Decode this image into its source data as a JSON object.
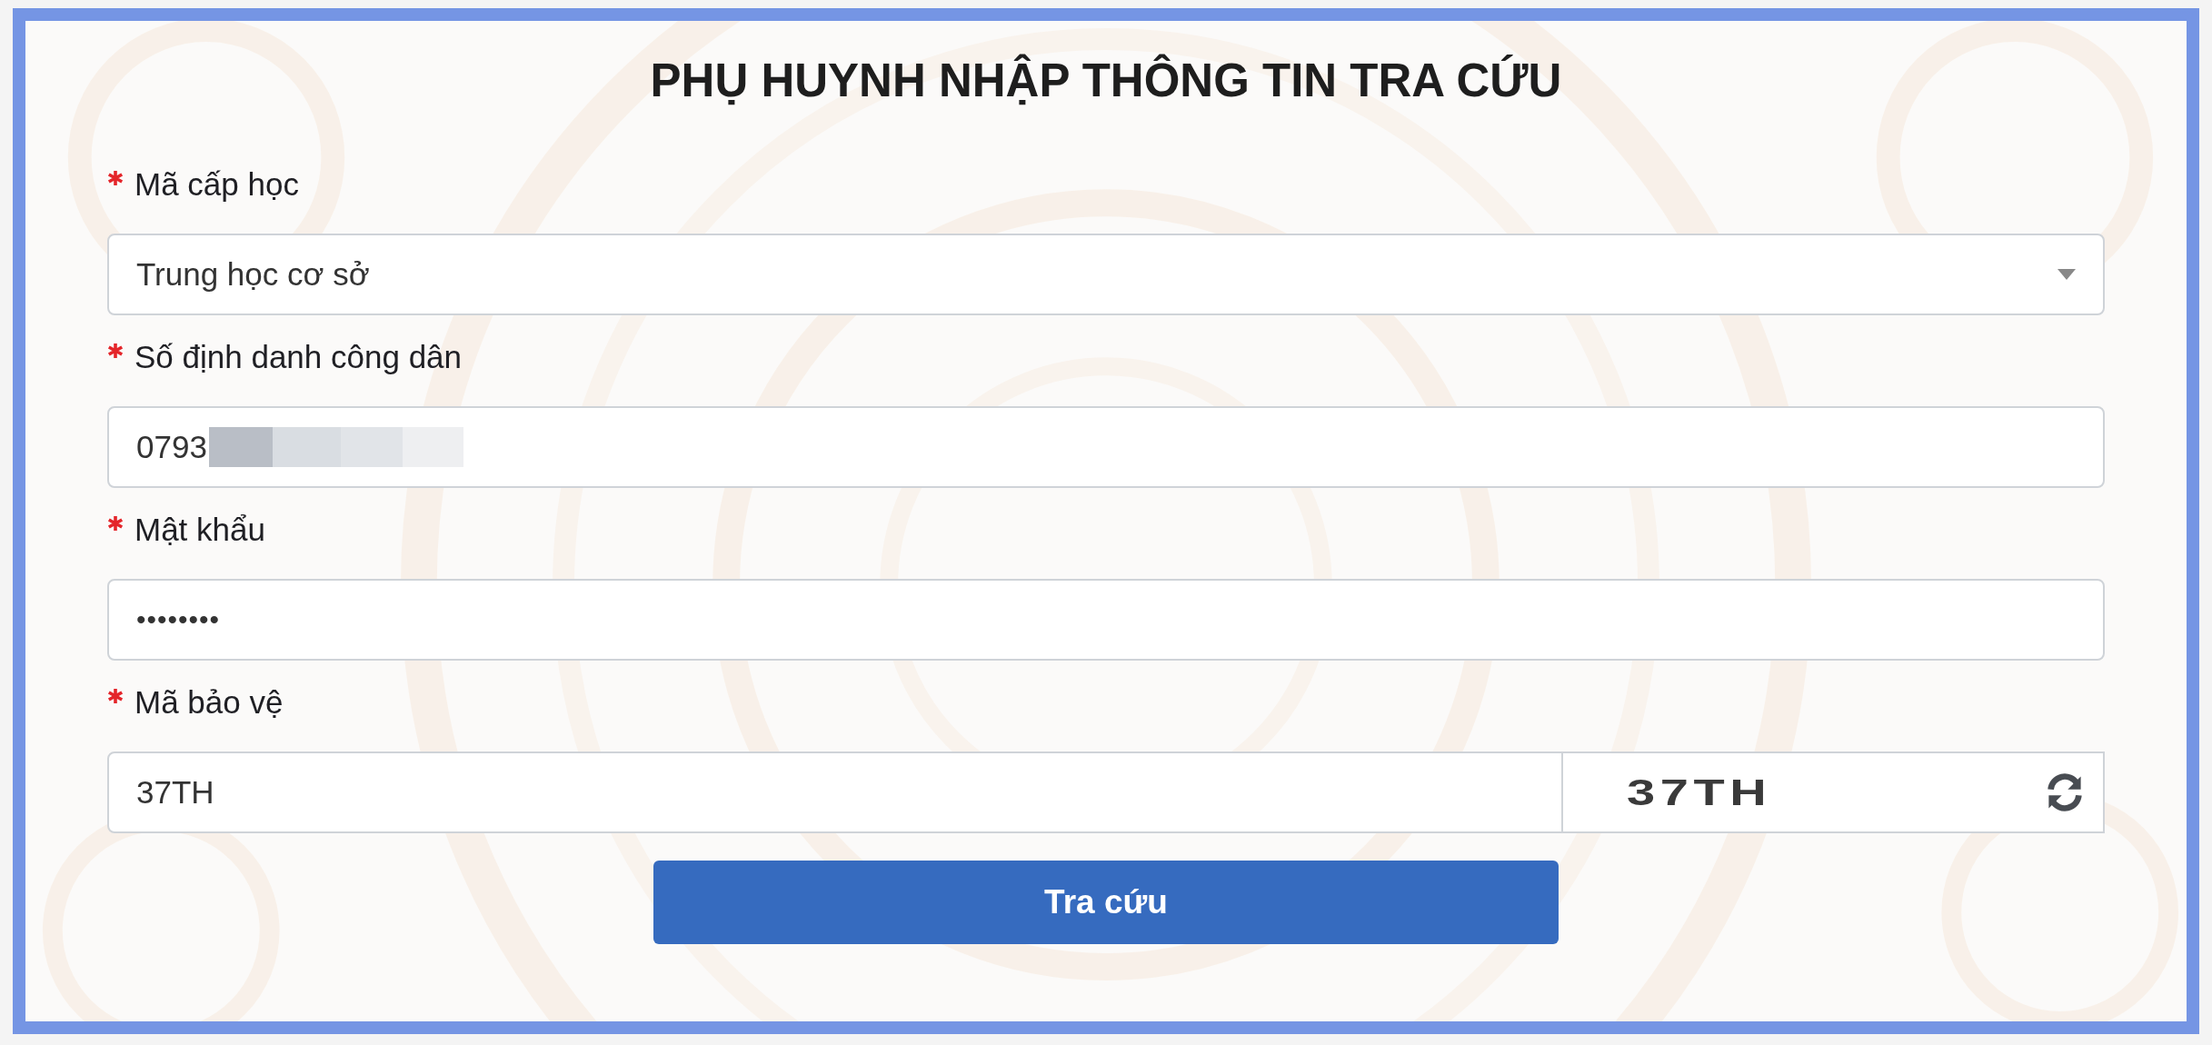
{
  "title": "PHỤ HUYNH NHẬP THÔNG TIN TRA CỨU",
  "fields": [
    {
      "kind": "select",
      "label": "Mã cấp học",
      "required": true,
      "value": "Trung học cơ sở"
    },
    {
      "kind": "text",
      "label": "Số định danh công dân",
      "required": true,
      "value": "0793",
      "redacted": true
    },
    {
      "kind": "password",
      "label": "Mật khẩu",
      "required": true,
      "value": "••••••••"
    },
    {
      "kind": "captcha",
      "label": "Mã bảo vệ",
      "required": true,
      "value": "37TH",
      "captcha_text": "37TH"
    }
  ],
  "submit_button": "Tra cứu"
}
